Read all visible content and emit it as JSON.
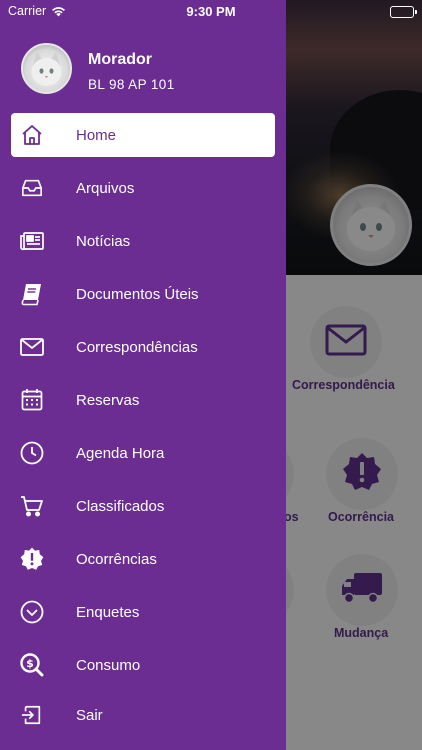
{
  "status_bar": {
    "carrier": "Carrier",
    "time": "9:30 PM"
  },
  "profile": {
    "name": "Morador",
    "unit": "BL 98 AP 101"
  },
  "menu": {
    "items": [
      {
        "label": "Home",
        "icon": "home-icon"
      },
      {
        "label": "Arquivos",
        "icon": "inbox-tray-icon"
      },
      {
        "label": "Notícias",
        "icon": "newspaper-icon"
      },
      {
        "label": "Documentos Úteis",
        "icon": "book-icon"
      },
      {
        "label": "Correspondências",
        "icon": "envelope-icon"
      },
      {
        "label": "Reservas",
        "icon": "calendar-icon"
      },
      {
        "label": "Agenda Hora",
        "icon": "clock-icon"
      },
      {
        "label": "Classificados",
        "icon": "shopping-cart-icon"
      },
      {
        "label": "Ocorrências",
        "icon": "alert-badge-icon"
      },
      {
        "label": "Enquetes",
        "icon": "chevron-circle-icon"
      },
      {
        "label": "Consumo",
        "icon": "search-dollar-icon"
      },
      {
        "label": "Sair",
        "icon": "logout-icon"
      }
    ],
    "active_index": 0
  },
  "background": {
    "tiles": [
      {
        "label": "Correspondência",
        "icon": "envelope-icon"
      },
      {
        "label": "os",
        "icon": "partial-tile-icon"
      },
      {
        "label": "Ocorrência",
        "icon": "alert-badge-icon"
      },
      {
        "label": "Mudança",
        "icon": "truck-icon"
      }
    ]
  },
  "colors": {
    "drawer": "#6b2d92",
    "accent_text": "#6b2d92",
    "tile_label": "#5b2e86"
  }
}
